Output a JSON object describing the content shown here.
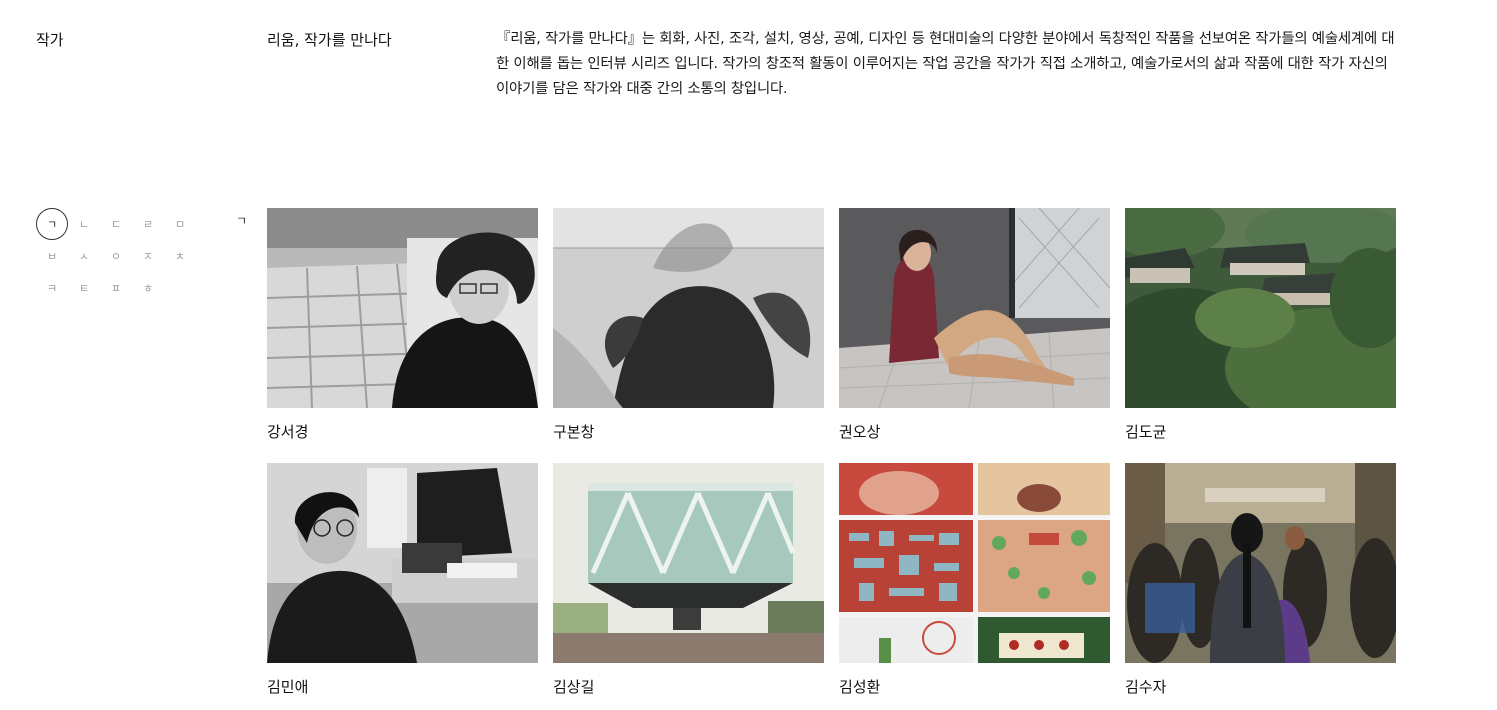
{
  "section": {
    "label": "작가"
  },
  "series": {
    "title": "리움, 작가를 만나다",
    "description": "『리움, 작가를 만나다』는 회화, 사진, 조각, 설치, 영상, 공예, 디자인 등 현대미술의 다양한 분야에서 독창적인 작품을 선보여온 작가들의 예술세계에 대한 이해를 돕는 인터뷰 시리즈 입니다. 작가의 창조적 활동이 이루어지는 작업 공간을 작가가 직접 소개하고, 예술가로서의 삶과 작품에 대한 작가 자신의 이야기를 담은 작가와 대중 간의 소통의 창입니다."
  },
  "index": {
    "consonants": [
      "ㄱ",
      "ㄴ",
      "ㄷ",
      "ㄹ",
      "ㅁ",
      "ㅂ",
      "ㅅ",
      "ㅇ",
      "ㅈ",
      "ㅊ",
      "ㅋ",
      "ㅌ",
      "ㅍ",
      "ㅎ"
    ],
    "active": "ㄱ",
    "corner": "ㄱ"
  },
  "artists": [
    {
      "name": "강서경",
      "photo": "portrait-bw-studio"
    },
    {
      "name": "구본창",
      "photo": "bw-figure-photo"
    },
    {
      "name": "권오상",
      "photo": "sculpture-seated-girl"
    },
    {
      "name": "김도균",
      "photo": "village-landscape"
    },
    {
      "name": "김민애",
      "photo": "portrait-bw-desk"
    },
    {
      "name": "김상길",
      "photo": "building-architecture"
    },
    {
      "name": "김성환",
      "photo": "collage-grid"
    },
    {
      "name": "김수자",
      "photo": "crowd-street"
    }
  ]
}
